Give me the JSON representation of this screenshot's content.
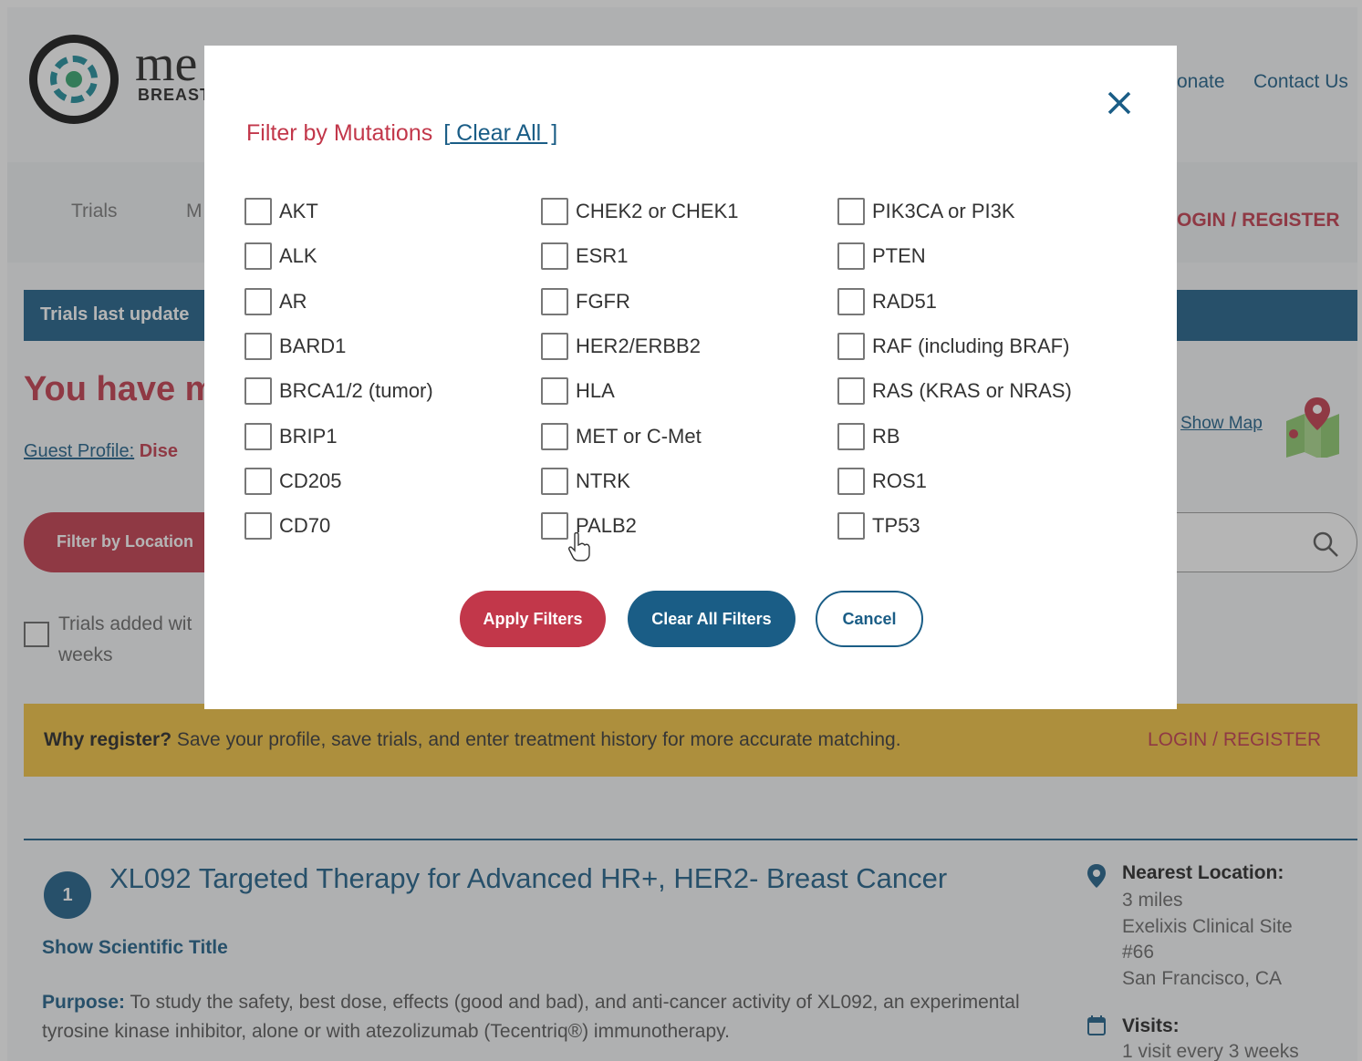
{
  "header": {
    "logo_text": "me",
    "logo_sub": "BREAST C",
    "donate": "onate",
    "contact": "Contact Us",
    "nav": [
      "Trials",
      "M"
    ],
    "login": "OGIN / REGISTER"
  },
  "banner": {
    "text": "Trials last update"
  },
  "results": {
    "heading": "You have m",
    "guest_label": "Guest Profile:",
    "guest_value": "Dise",
    "show_map": "Show Map",
    "filter_location": "Filter by Location",
    "recent_label": "Trials added wit weeks"
  },
  "register_bar": {
    "bold": "Why register?",
    "text": " Save your profile, save trials, and enter treatment history for more accurate matching.",
    "login": "LOGIN / REGISTER"
  },
  "trial": {
    "number": "1",
    "title": "XL092 Targeted Therapy for Advanced HR+, HER2- Breast Cancer",
    "scientific_link": "Show Scientific Title",
    "purpose_label": "Purpose:",
    "purpose_text": " To study the safety, best dose, effects (good and bad), and anti-cancer activity of XL092, an experimental tyrosine kinase inhibitor, alone or with atezolizumab (Tecentriq®) immunotherapy.",
    "nearest_label": "Nearest Location:",
    "distance": "3 miles",
    "site_line1": "Exelixis Clinical Site",
    "site_line2": "#66",
    "city": "San Francisco, CA",
    "visits_label": "Visits:",
    "visits_value": "1 visit every 3 weeks"
  },
  "modal": {
    "title": "Filter by Mutations",
    "bracket_open": "[",
    "clear_all": " Clear All ",
    "bracket_close": "]",
    "columns": [
      [
        "AKT",
        "ALK",
        "AR",
        "BARD1",
        "BRCA1/2 (tumor)",
        "BRIP1",
        "CD205",
        "CD70"
      ],
      [
        "CHEK2 or CHEK1",
        "ESR1",
        "FGFR",
        "HER2/ERBB2",
        "HLA",
        "MET or C-Met",
        "NTRK",
        "PALB2"
      ],
      [
        "PIK3CA or PI3K",
        "PTEN",
        "RAD51",
        "RAF (including BRAF)",
        "RAS (KRAS or NRAS)",
        "RB",
        "ROS1",
        "TP53"
      ]
    ],
    "apply": "Apply Filters",
    "clear_filters": "Clear All Filters",
    "cancel": "Cancel"
  },
  "colors": {
    "brand_red": "#c2374a",
    "brand_blue": "#1a5d86",
    "register_yellow": "#f2c23e"
  }
}
